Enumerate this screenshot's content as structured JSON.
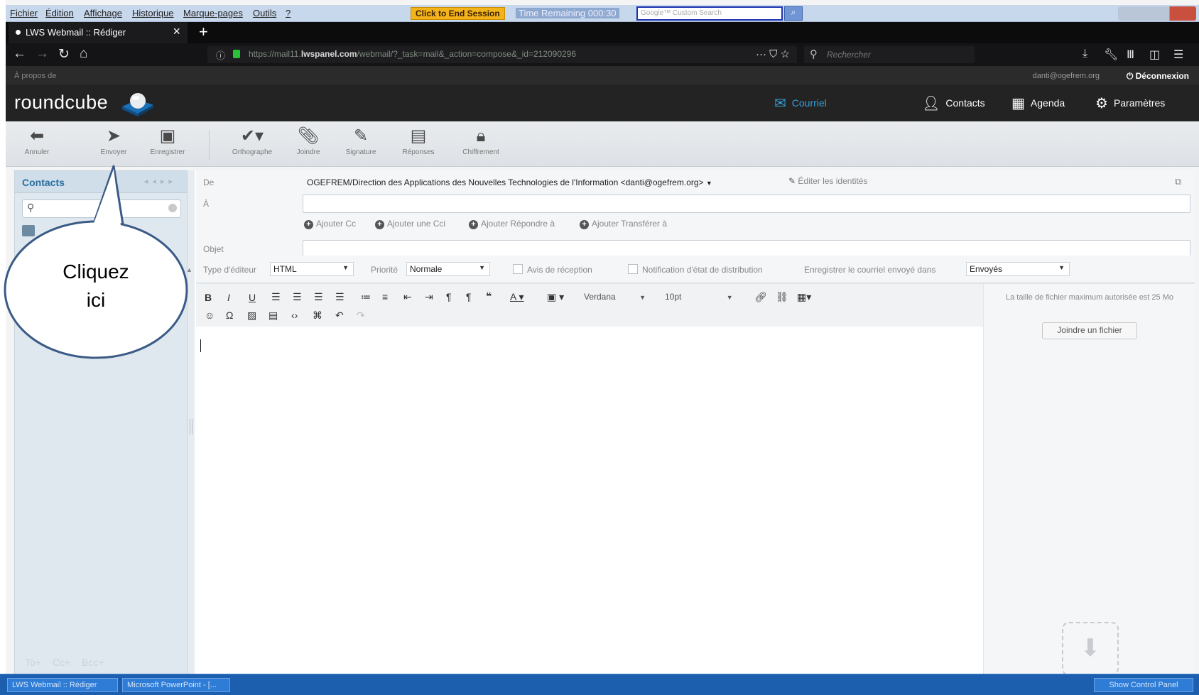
{
  "menubar": {
    "items": [
      "Fichier",
      "Édition",
      "Affichage",
      "Historique",
      "Marque-pages",
      "Outils",
      "?"
    ],
    "end_session": "Click to End Session",
    "time_remaining": "Time Remaining 000:30",
    "google_placeholder": "Google™ Custom Search"
  },
  "tab": {
    "title": "LWS Webmail :: Rédiger",
    "close": "×",
    "new": "+"
  },
  "nav": {
    "url_prefix": "https://mail11.",
    "url_domain": "lwspanel.com",
    "url_suffix": "/webmail/?_task=mail&_action=compose&_id=212090296",
    "page_actions": "··· ⛉ ☆",
    "search_placeholder": "Rechercher"
  },
  "topline": {
    "about": "À propos de",
    "user": "danti@ogefrem.org",
    "logout": "Déconnexion"
  },
  "header": {
    "logo": "roundcube",
    "tasks": [
      {
        "label": "Courriel"
      },
      {
        "label": "Contacts"
      },
      {
        "label": "Agenda"
      },
      {
        "label": "Paramètres"
      }
    ]
  },
  "toolbar": {
    "annuler": "Annuler",
    "envoyer": "Envoyer",
    "enregistrer": "Enregistrer",
    "orthographe": "Orthographe",
    "joindre": "Joindre",
    "signature": "Signature",
    "reponses": "Réponses",
    "chiffrement": "Chiffrement"
  },
  "contacts": {
    "title": "Contacts",
    "footer": [
      "To+",
      "Cc+",
      "Bcc+"
    ]
  },
  "compose": {
    "from_label": "De",
    "from_value": "OGEFREM/Direction des Applications des Nouvelles Technologies de l'Information <danti@ogefrem.org>",
    "edit_identities": "Éditer les identités",
    "to_label": "À",
    "add_cc": "Ajouter Cc",
    "add_bcc": "Ajouter une Cci",
    "add_reply": "Ajouter Répondre à",
    "add_followup": "Ajouter Transférer à",
    "subject_label": "Objet",
    "editor_type_label": "Type d'éditeur",
    "editor_type_value": "HTML",
    "priority_label": "Priorité",
    "priority_value": "Normale",
    "receipt_label": "Avis de réception",
    "dsn_label": "Notification d'état de distribution",
    "save_in_label": "Enregistrer le courriel envoyé dans",
    "save_in_value": "Envoyés",
    "font_name": "Verdana",
    "font_size": "10pt"
  },
  "attachments": {
    "info": "La taille de fichier maximum autorisée est 25 Mo",
    "button": "Joindre un fichier"
  },
  "callout": {
    "line1": "Cliquez",
    "line2": "ici"
  },
  "taskbar": {
    "item1": "LWS Webmail :: Rédiger",
    "item2": "Microsoft PowerPoint - [...",
    "show_panel": "Show Control Panel"
  },
  "colors": {
    "accent": "#34a1dc",
    "header_bg": "#232323",
    "callout_stroke": "#3b5b86"
  }
}
